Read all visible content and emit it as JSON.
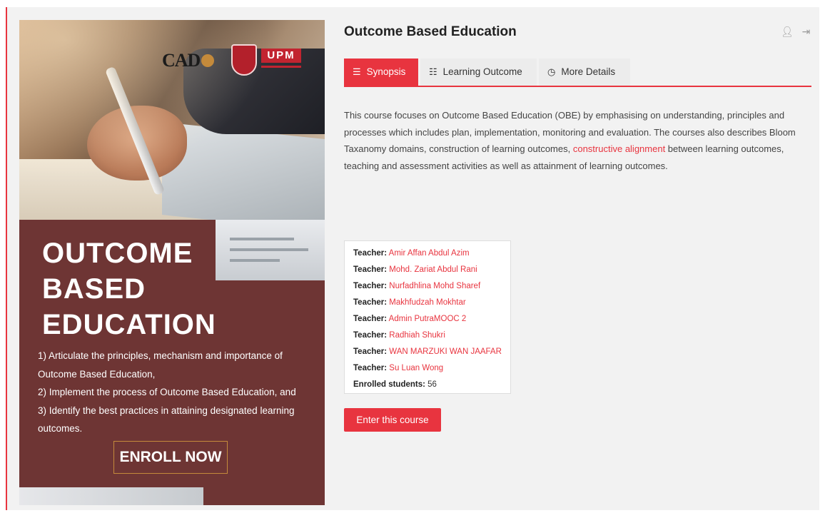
{
  "course": {
    "title": "Outcome Based Education"
  },
  "header_icons": {
    "user": "user-icon",
    "logout": "logout-icon"
  },
  "tabs": [
    {
      "label": "Synopsis",
      "icon": "list-icon",
      "active": true
    },
    {
      "label": "Learning Outcome",
      "icon": "list-bullets-icon",
      "active": false
    },
    {
      "label": "More Details",
      "icon": "clock-icon",
      "active": false
    }
  ],
  "synopsis": {
    "text_before": "This course focuses on Outcome Based Education (OBE) by emphasising on understanding, principles and processes which includes plan, implementation, monitoring and evaluation. The courses also describes Bloom Taxanomy domains, construction of learning outcomes, ",
    "link": "constructive alignment",
    "text_after": " between learning outcomes, teaching and assessment activities as well as attainment of learning outcomes."
  },
  "teachers": {
    "label": "Teacher:",
    "names": [
      "Amir Affan Abdul Azim",
      "Mohd. Zariat Abdul Rani",
      "Nurfadhlina Mohd Sharef",
      "Makhfudzah Mokhtar",
      "Admin PutraMOOC 2",
      "Radhiah Shukri",
      "WAN MARZUKI WAN JAAFAR",
      "Su Luan Wong"
    ],
    "enrolled_label": "Enrolled students:",
    "enrolled_count": "56"
  },
  "enter_button": "Enter this course",
  "banner": {
    "logo_cad": "CAD",
    "logo_upm": "UPM",
    "title_line1": "OUTCOME",
    "title_line2": "BASED",
    "title_line3": "EDUCATION",
    "points": [
      "1) Articulate the principles, mechanism and importance of Outcome Based Education,",
      "2) Implement the process of Outcome Based Education, and",
      "3) Identify the best practices in attaining designated learning outcomes."
    ],
    "enroll_label": "ENROLL NOW"
  },
  "colors": {
    "accent": "#e8343f",
    "banner_bg": "#6e3534",
    "enroll_border": "#c48a3b"
  }
}
